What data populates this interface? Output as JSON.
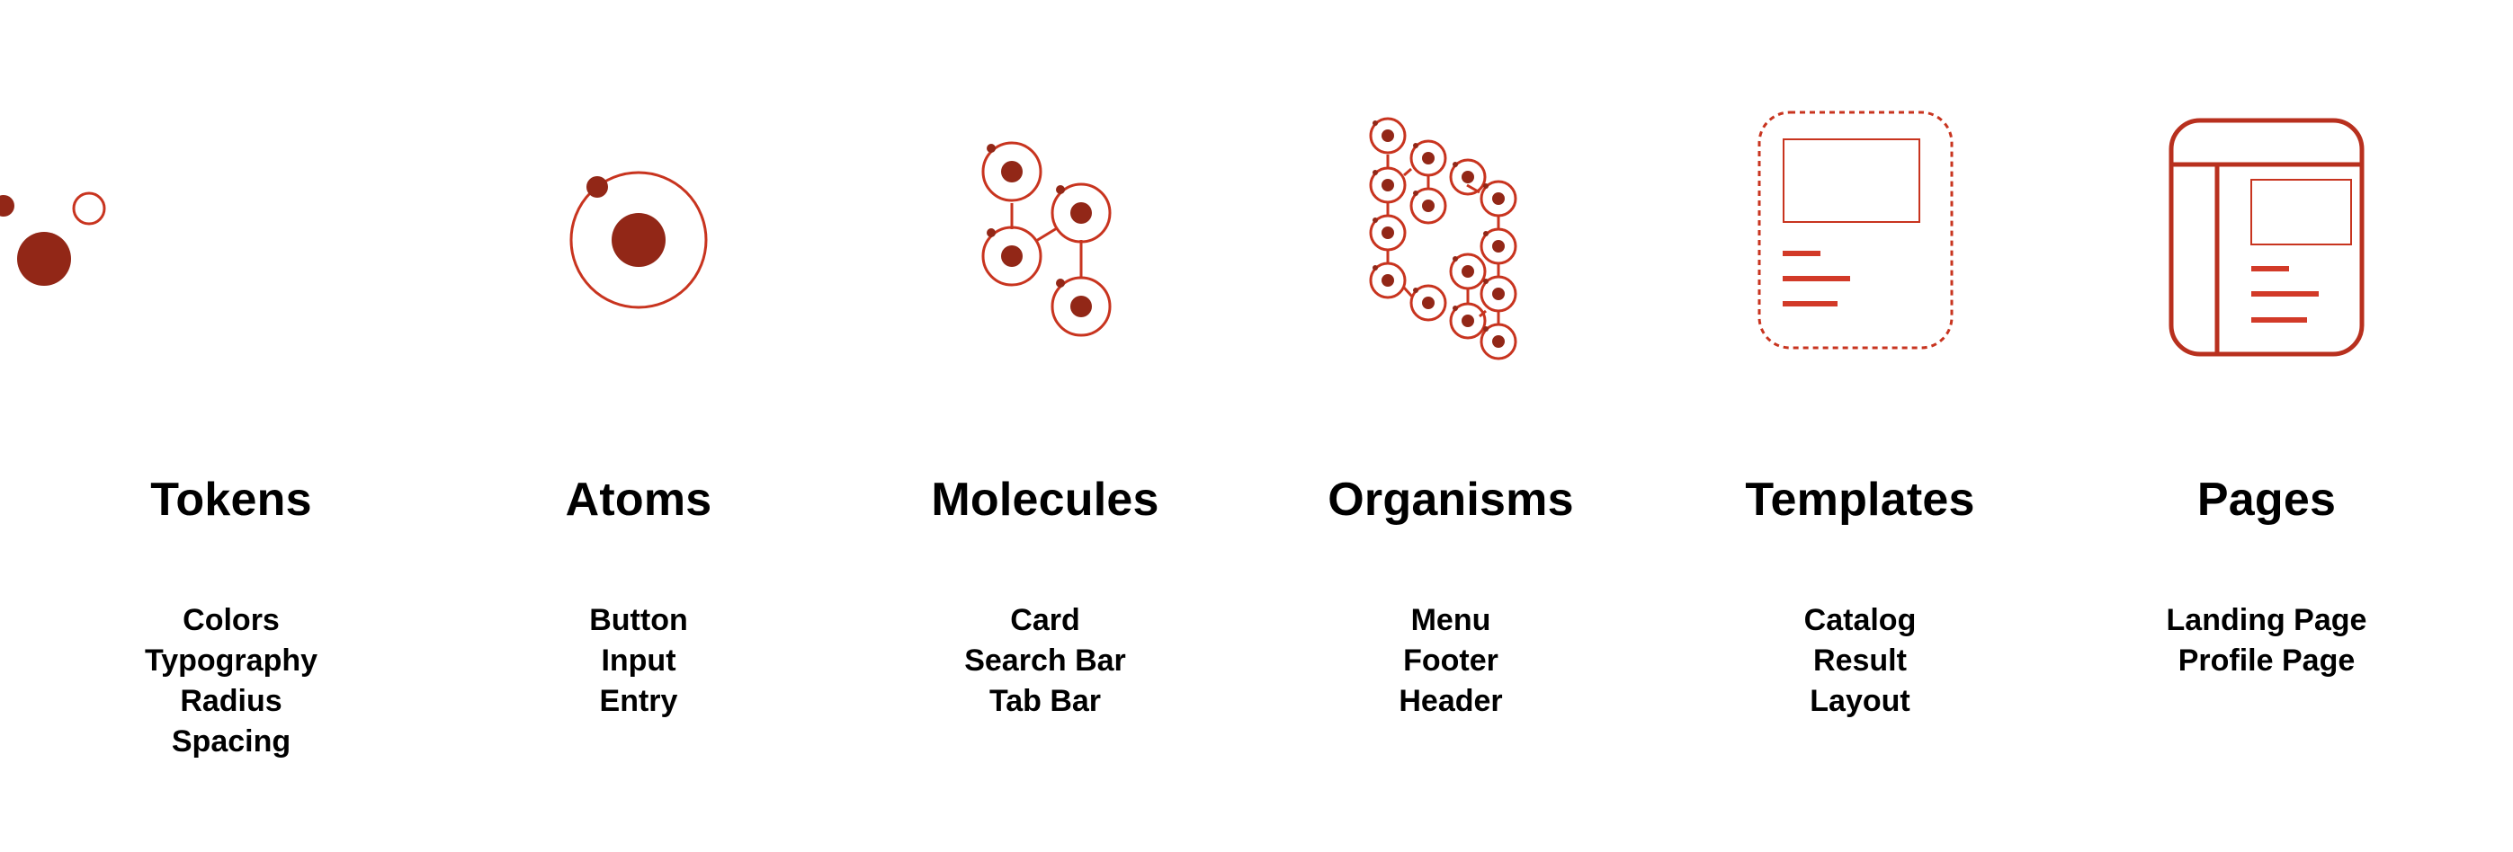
{
  "colors": {
    "accent_dark": "#922717",
    "accent_light": "#d23a28",
    "text": "#000000",
    "background": "#ffffff"
  },
  "stages": [
    {
      "title": "Tokens",
      "icon": "tokens-icon",
      "items": [
        "Colors",
        "Typography",
        "Radius",
        "Spacing"
      ]
    },
    {
      "title": "Atoms",
      "icon": "atom-icon",
      "items": [
        "Button",
        "Input",
        "Entry"
      ]
    },
    {
      "title": "Molecules",
      "icon": "molecule-icon",
      "items": [
        "Card",
        "Search Bar",
        "Tab Bar"
      ]
    },
    {
      "title": "Organisms",
      "icon": "organism-icon",
      "items": [
        "Menu",
        "Footer",
        "Header"
      ]
    },
    {
      "title": "Templates",
      "icon": "template-icon",
      "items": [
        "Catalog",
        "Result",
        "Layout"
      ]
    },
    {
      "title": "Pages",
      "icon": "page-icon",
      "items": [
        "Landing Page",
        "Profile Page"
      ]
    }
  ]
}
